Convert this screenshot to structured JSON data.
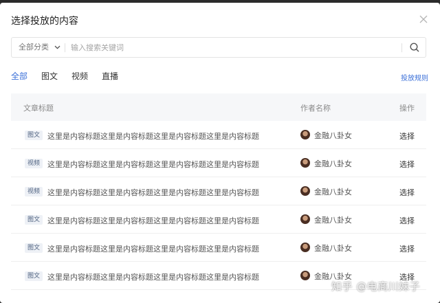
{
  "dialog": {
    "title": "选择投放的内容"
  },
  "search": {
    "category_label": "全部分类",
    "placeholder": "输入搜索关键词"
  },
  "tabs": [
    {
      "label": "全部",
      "active": true
    },
    {
      "label": "图文",
      "active": false
    },
    {
      "label": "视频",
      "active": false
    },
    {
      "label": "直播",
      "active": false
    }
  ],
  "rule_link": "投放规则",
  "table": {
    "headers": {
      "title": "文章标题",
      "author": "作者名称",
      "action": "操作"
    },
    "rows": [
      {
        "tag": "图文",
        "title": "这里是内容标题这里是内容标题这里是内容标题这里是内容标题",
        "author": "金融八卦女",
        "action": "选择"
      },
      {
        "tag": "视频",
        "title": "这里是内容标题这里是内容标题这里是内容标题这里是内容标题",
        "author": "金融八卦女",
        "action": "选择"
      },
      {
        "tag": "视频",
        "title": "这里是内容标题这里是内容标题这里是内容标题这里是内容标题",
        "author": "金融八卦女",
        "action": "选择"
      },
      {
        "tag": "图文",
        "title": "这里是内容标题这里是内容标题这里是内容标题这里是内容标题",
        "author": "金融八卦女",
        "action": "选择"
      },
      {
        "tag": "图文",
        "title": "这里是内容标题这里是内容标题这里是内容标题这里是内容标题",
        "author": "金融八卦女",
        "action": "选择"
      },
      {
        "tag": "图文",
        "title": "这里是内容标题这里是内容标题这里是内容标题这里是内容标题",
        "author": "金融八卦女",
        "action": "选择"
      }
    ]
  },
  "watermark": "知乎 @电商川妹子",
  "icons": {
    "close": "close-icon",
    "search": "search-icon",
    "chevron": "chevron-down-icon"
  },
  "colors": {
    "accent": "#3a6fd8",
    "header_bg": "#f6f7f9",
    "tag_bg": "#eef1f6"
  }
}
